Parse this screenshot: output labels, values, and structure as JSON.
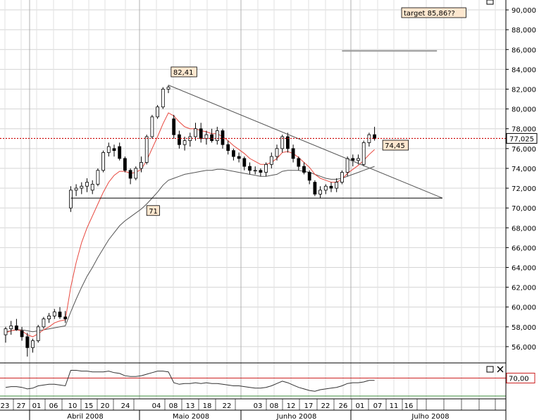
{
  "chart_data": {
    "type": "candlestick",
    "title": "",
    "ylim": [
      54.5,
      91
    ],
    "y_ticks": [
      56,
      58,
      60,
      62,
      64,
      66,
      68,
      70,
      72,
      74,
      76,
      78,
      80,
      82,
      84,
      86,
      88,
      90
    ],
    "y_tick_labels": [
      "56,000",
      "58,000",
      "60,000",
      "62,000",
      "64,000",
      "66,000",
      "68,000",
      "70,000",
      "72,000",
      "74,000",
      "76,000",
      "78,000",
      "80,000",
      "82,000",
      "84,000",
      "86,000",
      "88,000",
      "90,000"
    ],
    "x_day_labels": [
      "23",
      "27",
      "01",
      "06",
      "10",
      "15",
      "20",
      "24",
      "04",
      "08",
      "13",
      "18",
      "22",
      "03",
      "08",
      "12",
      "17",
      "22",
      "26",
      "01",
      "07",
      "11",
      "16"
    ],
    "x_month_labels": [
      "Abril 2008",
      "Maio 2008",
      "Junho 2008",
      "Julho 2008"
    ],
    "last_price_label": "77,025",
    "last_price": 77.025,
    "candles": [
      [
        57.2,
        58.0,
        56.4,
        57.8
      ],
      [
        57.8,
        58.6,
        57.2,
        58.1
      ],
      [
        58.1,
        58.8,
        57.6,
        57.7
      ],
      [
        57.6,
        58.0,
        56.6,
        57.0
      ],
      [
        57.0,
        57.4,
        55.0,
        55.9
      ],
      [
        55.9,
        56.8,
        55.4,
        56.6
      ],
      [
        56.6,
        58.2,
        56.4,
        58.0
      ],
      [
        58.0,
        59.0,
        57.8,
        58.8
      ],
      [
        58.8,
        59.4,
        58.4,
        59.1
      ],
      [
        59.1,
        59.8,
        58.8,
        59.5
      ],
      [
        59.5,
        60.0,
        58.8,
        59.0
      ],
      [
        59.0,
        59.6,
        58.4,
        58.8
      ],
      [
        70.0,
        72.2,
        69.6,
        71.8
      ],
      [
        71.8,
        72.4,
        71.2,
        72.0
      ],
      [
        72.0,
        72.6,
        71.4,
        72.2
      ],
      [
        72.2,
        73.0,
        71.6,
        72.6
      ],
      [
        71.8,
        72.8,
        71.4,
        72.4
      ],
      [
        72.4,
        74.0,
        72.2,
        73.8
      ],
      [
        73.8,
        75.8,
        73.6,
        75.6
      ],
      [
        75.6,
        76.6,
        75.2,
        76.2
      ],
      [
        76.0,
        76.4,
        75.2,
        75.8
      ],
      [
        76.2,
        76.6,
        74.8,
        75.0
      ],
      [
        75.0,
        75.2,
        73.6,
        73.8
      ],
      [
        73.8,
        74.0,
        72.4,
        73.0
      ],
      [
        73.0,
        74.2,
        72.8,
        74.0
      ],
      [
        74.0,
        75.2,
        73.6,
        74.6
      ],
      [
        74.6,
        77.4,
        74.4,
        77.2
      ],
      [
        77.2,
        79.4,
        77.0,
        79.2
      ],
      [
        79.2,
        80.4,
        79.0,
        80.2
      ],
      [
        80.2,
        82.2,
        80.0,
        82.0
      ],
      [
        82.0,
        82.41,
        81.6,
        82.2
      ],
      [
        79.0,
        79.4,
        77.0,
        77.4
      ],
      [
        77.4,
        77.8,
        76.0,
        76.4
      ],
      [
        76.4,
        77.2,
        75.8,
        76.8
      ],
      [
        76.8,
        77.6,
        76.2,
        77.2
      ],
      [
        77.2,
        78.6,
        76.8,
        78.0
      ],
      [
        78.0,
        78.6,
        76.6,
        77.0
      ],
      [
        77.0,
        77.8,
        76.4,
        77.4
      ],
      [
        77.4,
        78.0,
        76.6,
        76.8
      ],
      [
        76.8,
        78.2,
        76.4,
        77.8
      ],
      [
        77.8,
        78.0,
        76.0,
        76.4
      ],
      [
        76.4,
        76.8,
        75.4,
        75.8
      ],
      [
        75.8,
        76.0,
        74.8,
        75.2
      ],
      [
        75.2,
        75.6,
        74.6,
        75.0
      ],
      [
        75.0,
        75.2,
        73.8,
        74.2
      ],
      [
        74.2,
        74.6,
        73.4,
        73.8
      ],
      [
        73.8,
        74.2,
        73.4,
        73.8
      ],
      [
        73.8,
        74.0,
        73.2,
        73.6
      ],
      [
        73.6,
        74.6,
        73.2,
        74.4
      ],
      [
        74.4,
        75.6,
        74.0,
        75.2
      ],
      [
        75.2,
        76.4,
        74.8,
        76.0
      ],
      [
        76.0,
        77.4,
        75.6,
        77.2
      ],
      [
        77.2,
        77.6,
        75.6,
        76.0
      ],
      [
        76.0,
        76.4,
        74.6,
        75.0
      ],
      [
        75.0,
        75.2,
        73.8,
        74.2
      ],
      [
        74.2,
        74.6,
        73.4,
        73.6
      ],
      [
        73.6,
        73.8,
        72.4,
        72.8
      ],
      [
        72.6,
        72.8,
        71.2,
        71.4
      ],
      [
        71.4,
        72.2,
        71.0,
        71.8
      ],
      [
        71.8,
        72.4,
        71.4,
        72.2
      ],
      [
        72.2,
        72.6,
        71.6,
        72.0
      ],
      [
        72.0,
        73.0,
        71.6,
        72.6
      ],
      [
        72.6,
        73.8,
        72.4,
        73.6
      ],
      [
        73.6,
        75.2,
        73.2,
        75.0
      ],
      [
        75.0,
        75.4,
        74.2,
        74.8
      ],
      [
        74.8,
        75.4,
        74.4,
        75.0
      ],
      [
        74.4,
        76.8,
        74.2,
        76.6
      ],
      [
        76.6,
        77.6,
        76.2,
        77.4
      ],
      [
        77.4,
        78.2,
        76.8,
        77.0
      ]
    ],
    "ema_fast": [
      57.4,
      57.6,
      57.7,
      57.6,
      57.2,
      57.0,
      57.3,
      57.7,
      58.0,
      58.4,
      58.6,
      58.7,
      62.0,
      64.5,
      66.5,
      68.0,
      69.2,
      70.4,
      71.6,
      72.6,
      73.3,
      73.7,
      73.7,
      73.5,
      73.6,
      73.9,
      74.8,
      76.0,
      77.2,
      78.5,
      79.6,
      79.3,
      78.7,
      78.2,
      78.0,
      78.0,
      77.8,
      77.7,
      77.5,
      77.5,
      77.2,
      76.8,
      76.3,
      75.9,
      75.5,
      75.0,
      74.7,
      74.4,
      74.4,
      74.6,
      75.0,
      75.6,
      75.7,
      75.5,
      75.1,
      74.6,
      74.1,
      73.4,
      73.0,
      72.8,
      72.6,
      72.6,
      72.9,
      73.5,
      73.9,
      74.3,
      74.8,
      75.4,
      75.9
    ],
    "ema_slow": [
      57.5,
      57.6,
      57.7,
      57.7,
      57.6,
      57.5,
      57.6,
      57.7,
      57.8,
      57.9,
      58.0,
      58.1,
      59.5,
      60.8,
      62.0,
      63.1,
      64.0,
      65.0,
      65.9,
      66.8,
      67.5,
      68.2,
      68.7,
      69.1,
      69.5,
      69.9,
      70.4,
      71.0,
      71.6,
      72.3,
      72.8,
      73.0,
      73.2,
      73.4,
      73.5,
      73.6,
      73.7,
      73.8,
      73.8,
      73.9,
      73.9,
      73.8,
      73.7,
      73.6,
      73.5,
      73.4,
      73.3,
      73.2,
      73.2,
      73.3,
      73.4,
      73.7,
      73.8,
      73.8,
      73.8,
      73.7,
      73.6,
      73.4,
      73.2,
      73.0,
      72.9,
      72.9,
      73.0,
      73.2,
      73.4,
      73.6,
      73.8,
      74.0,
      74.2
    ],
    "trendline": {
      "from": [
        30,
        82.41
      ],
      "to": [
        80.5,
        71.0
      ]
    },
    "support_line": {
      "from": [
        12,
        71.0
      ],
      "to": [
        80.5,
        71.0
      ],
      "label": "71"
    },
    "target_line": {
      "from": [
        62,
        85.86
      ],
      "to": [
        79.5,
        85.86
      ],
      "label": "target 85,86??"
    },
    "annotations": [
      {
        "label": "82,41",
        "x": 30.5,
        "y": 83.6
      },
      {
        "label": "71",
        "x": 26,
        "y": 69.6
      },
      {
        "label": "74,45",
        "x": 69.5,
        "y": 76.2
      }
    ],
    "indicator": {
      "reference_level": 70,
      "reference_label": "70,00",
      "values": [
        58,
        59,
        59,
        58,
        56,
        57,
        60,
        61,
        62,
        62,
        61,
        60,
        80,
        80,
        79,
        79,
        78,
        78,
        78,
        79,
        77,
        76,
        73,
        72,
        72,
        73,
        75,
        77,
        79,
        79,
        78,
        64,
        62,
        63,
        63,
        64,
        63,
        64,
        63,
        63,
        62,
        61,
        60,
        60,
        59,
        58,
        57,
        57,
        58,
        60,
        63,
        66,
        64,
        61,
        58,
        56,
        54,
        53,
        55,
        56,
        57,
        58,
        60,
        63,
        64,
        64,
        65,
        67,
        67
      ]
    }
  }
}
